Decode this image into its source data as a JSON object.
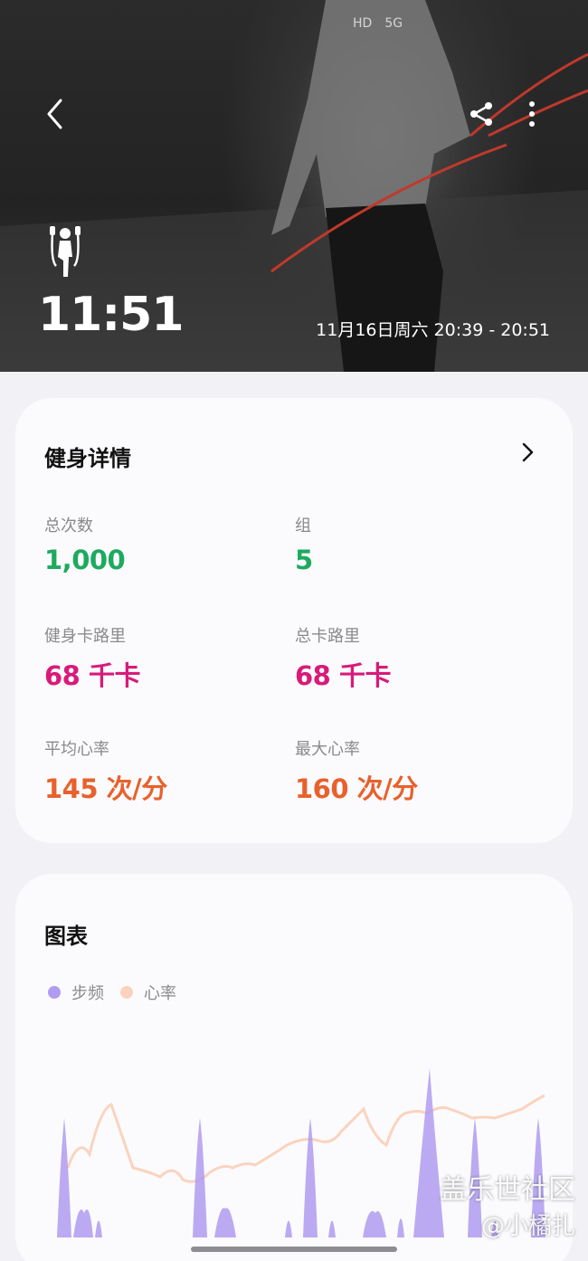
{
  "header": {
    "duration": "11:51",
    "time_range": "11月16日周六 20:39 - 20:51",
    "back_icon": "chevron-left-icon",
    "share_icon": "share-icon",
    "more_icon": "more-vertical-icon",
    "sport_icon": "jump-rope-icon",
    "status_bar": {
      "network": "HD",
      "signal": "5G"
    }
  },
  "details": {
    "title": "健身详情",
    "metrics": [
      {
        "label": "总次数",
        "value": "1,000",
        "color": "#1daa5f"
      },
      {
        "label": "组",
        "value": "5",
        "color": "#1daa5f"
      },
      {
        "label": "健身卡路里",
        "value": "68 千卡",
        "color": "#d81b7a"
      },
      {
        "label": "总卡路里",
        "value": "68 千卡",
        "color": "#d81b7a"
      },
      {
        "label": "平均心率",
        "value": "145 次/分",
        "color": "#e8612c"
      },
      {
        "label": "最大心率",
        "value": "160 次/分",
        "color": "#e8612c"
      }
    ]
  },
  "chart": {
    "title": "图表",
    "legend": [
      {
        "label": "步频",
        "color": "#b09cf0"
      },
      {
        "label": "心率",
        "color": "#fbd3bd"
      }
    ]
  },
  "watermark": {
    "line1": "盖乐世社区",
    "line2": "@小橘扎"
  }
}
